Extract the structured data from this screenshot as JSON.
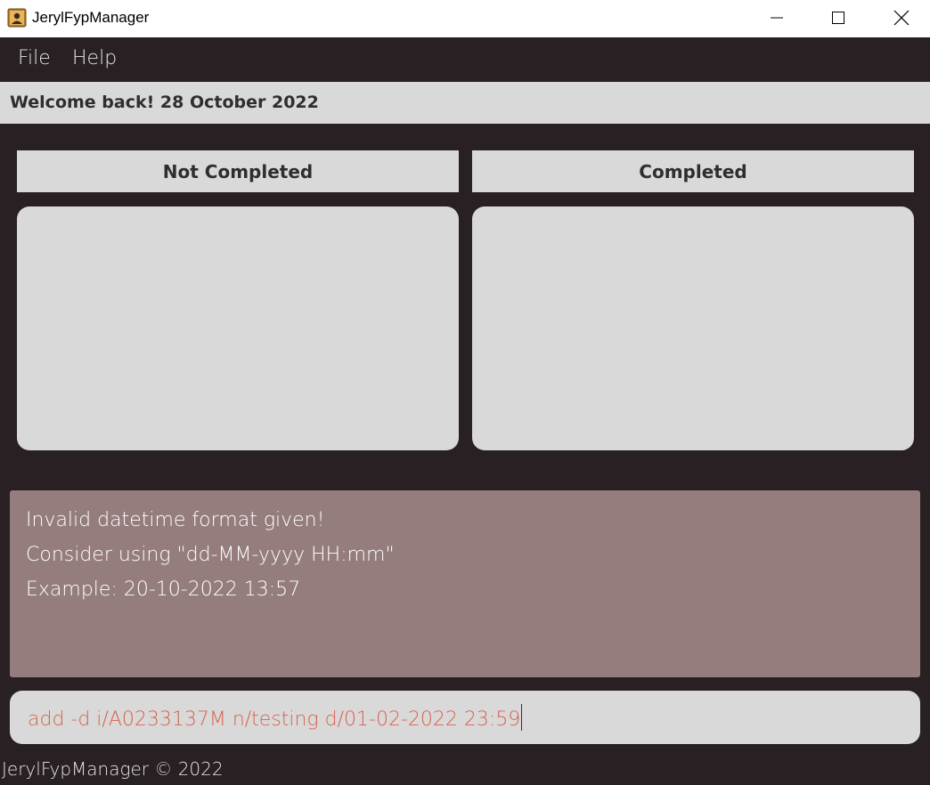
{
  "window": {
    "title": "JerylFypManager",
    "icon": "app-contact-icon"
  },
  "menu": {
    "items": [
      {
        "label": "File"
      },
      {
        "label": "Help"
      }
    ]
  },
  "welcome": {
    "text": "Welcome back! 28 October 2022"
  },
  "columns": {
    "left_title": "Not Completed",
    "right_title": "Completed"
  },
  "result": {
    "lines": [
      "Invalid datetime format given!",
      "Consider using \"dd-MM-yyyy HH:mm\"",
      "Example: 20-10-2022 13:57"
    ]
  },
  "command": {
    "value": "add -d i/A0233137M n/testing d/01-02-2022 23:59",
    "text_color": "#d8634f"
  },
  "footer": {
    "text": "JerylFypManager © 2022"
  },
  "colors": {
    "background": "#282023",
    "panel": "#d9d9d9",
    "result_box": "#957d7d"
  }
}
